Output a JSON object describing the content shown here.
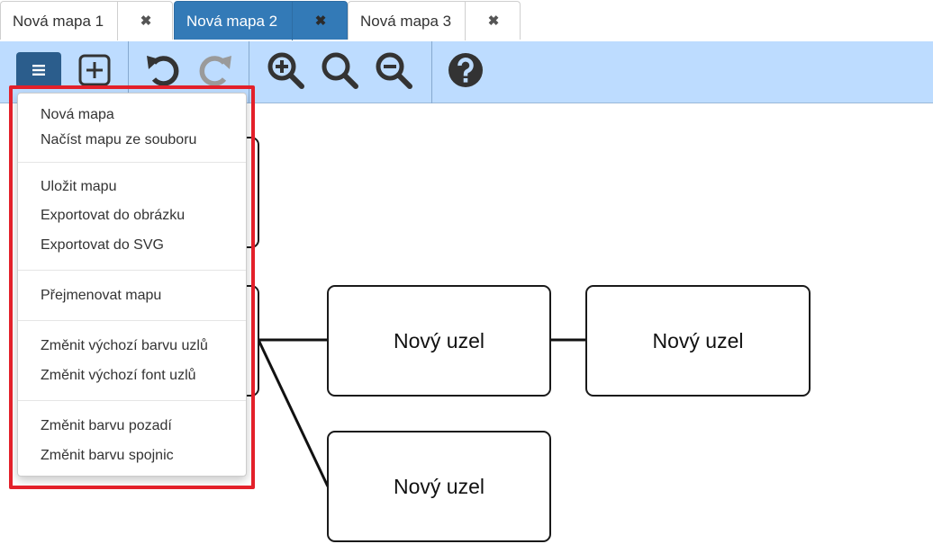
{
  "tabs": [
    {
      "label": "Nová mapa 1",
      "close": "✖",
      "active": false
    },
    {
      "label": "Nová mapa 2",
      "close": "✖",
      "active": true
    },
    {
      "label": "Nová mapa 3",
      "close": "✖",
      "active": false
    }
  ],
  "toolbar": {
    "icons": [
      "menu-icon",
      "add-node-icon",
      "undo-icon",
      "redo-icon",
      "zoom-in-icon",
      "zoom-reset-icon",
      "zoom-out-icon",
      "help-icon"
    ]
  },
  "menu": {
    "groups": [
      [
        "Nová mapa",
        "Načíst mapu ze souboru"
      ],
      [
        "Uložit mapu",
        "Exportovat do obrázku",
        "Exportovat do SVG"
      ],
      [
        "Přejmenovat mapu"
      ],
      [
        "Změnit výchozí barvu uzlů",
        "Změnit výchozí font uzlů"
      ],
      [
        "Změnit barvu pozadí",
        "Změnit barvu spojnic"
      ]
    ],
    "highlight_color": "#e3202a"
  },
  "map": {
    "nodes": [
      "Nový uzel",
      "Nový uzel",
      "Nový uzel"
    ]
  },
  "colors": {
    "accent": "#337ab7",
    "toolbar_bg": "#bddcff",
    "icon": "#333333",
    "icon_disabled": "#999999"
  }
}
